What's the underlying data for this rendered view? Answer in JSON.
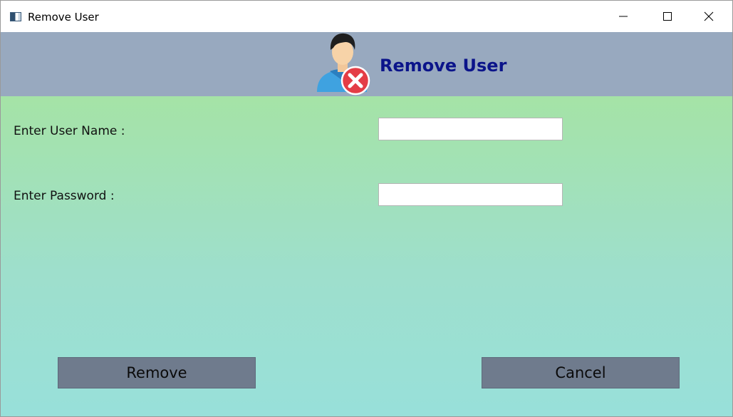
{
  "window": {
    "title": "Remove User",
    "icon": "app-window-icon",
    "controls": {
      "minimize_icon": "minimize-icon",
      "maximize_icon": "maximize-icon",
      "close_icon": "close-icon"
    }
  },
  "header": {
    "title": "Remove User",
    "icon": "remove-user-icon",
    "background_color": "#98a9bf",
    "title_color": "#0b148a"
  },
  "form": {
    "username_label": "Enter User Name :",
    "username_value": "",
    "password_label": "Enter Password :",
    "password_value": ""
  },
  "actions": {
    "remove_label": "Remove",
    "cancel_label": "Cancel",
    "button_color": "#6f7b8d"
  },
  "colors": {
    "form_gradient_top": "#a5e3a6",
    "form_gradient_bottom": "#98e0da"
  }
}
